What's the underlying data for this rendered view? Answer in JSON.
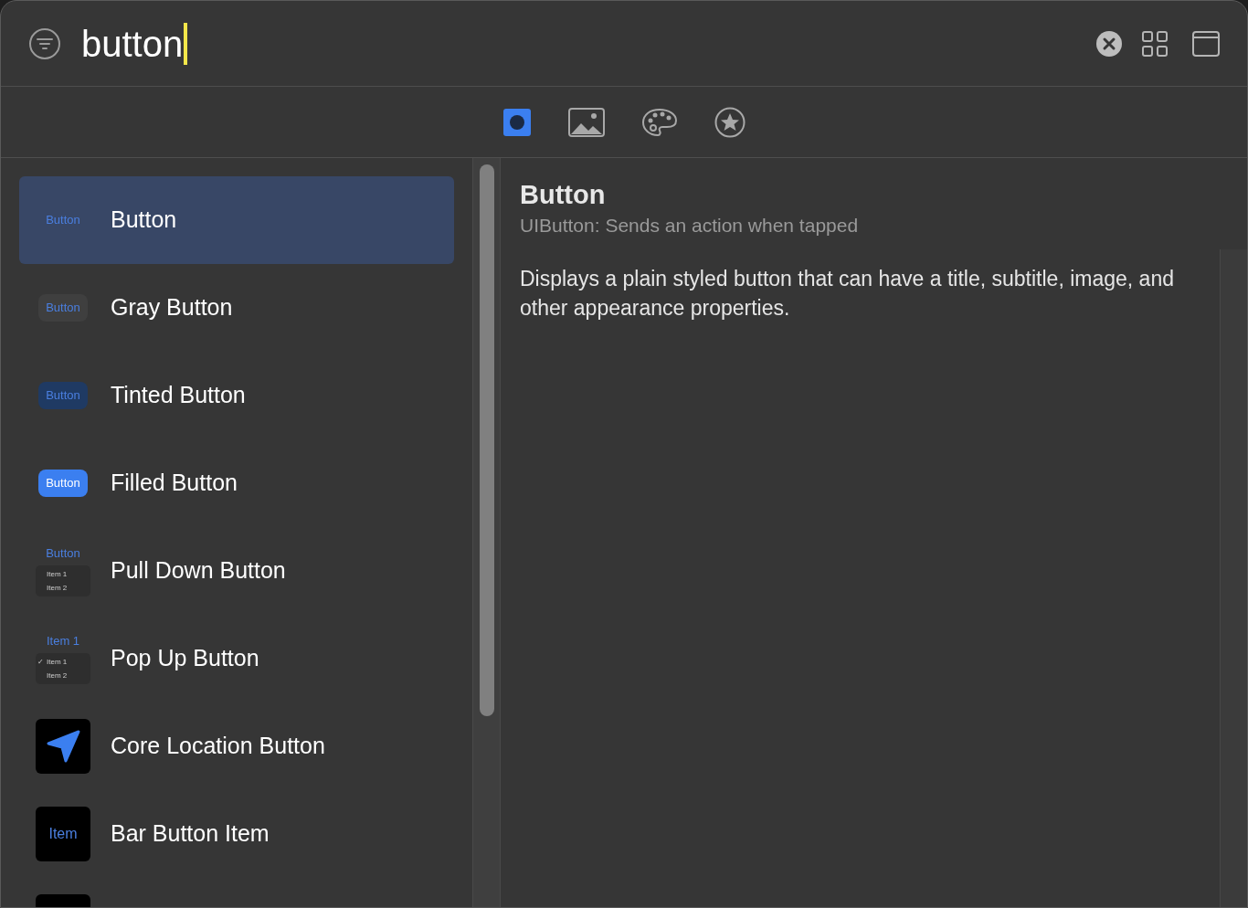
{
  "search": {
    "value": "button"
  },
  "tabs": [
    {
      "kind": "objects",
      "selected": true
    },
    {
      "kind": "media",
      "selected": false
    },
    {
      "kind": "colors",
      "selected": false
    },
    {
      "kind": "favorites",
      "selected": false
    }
  ],
  "items": [
    {
      "title": "Button",
      "kind": "plain",
      "thumb": [
        "Button"
      ],
      "selected": true
    },
    {
      "title": "Gray Button",
      "kind": "gray",
      "thumb": [
        "Button"
      ],
      "selected": false
    },
    {
      "title": "Tinted Button",
      "kind": "tinted",
      "thumb": [
        "Button"
      ],
      "selected": false
    },
    {
      "title": "Filled Button",
      "kind": "filled",
      "thumb": [
        "Button"
      ],
      "selected": false
    },
    {
      "title": "Pull Down Button",
      "kind": "pulldown",
      "thumb": [
        "Button",
        "Item 1",
        "Item 2"
      ],
      "selected": false
    },
    {
      "title": "Pop Up Button",
      "kind": "popup",
      "thumb": [
        "Item 1",
        "✓",
        "Item 1",
        "Item 2"
      ],
      "selected": false
    },
    {
      "title": "Core Location Button",
      "kind": "location",
      "selected": false
    },
    {
      "title": "Bar Button Item",
      "kind": "baritem",
      "thumb": [
        "Item"
      ],
      "selected": false
    },
    {
      "kind": "partial",
      "selected": false
    }
  ],
  "detail": {
    "title": "Button",
    "subtitle": "UIButton: Sends an action when tapped",
    "description": "Displays a plain styled button that can have a title, subtitle, image, and other appearance properties."
  }
}
